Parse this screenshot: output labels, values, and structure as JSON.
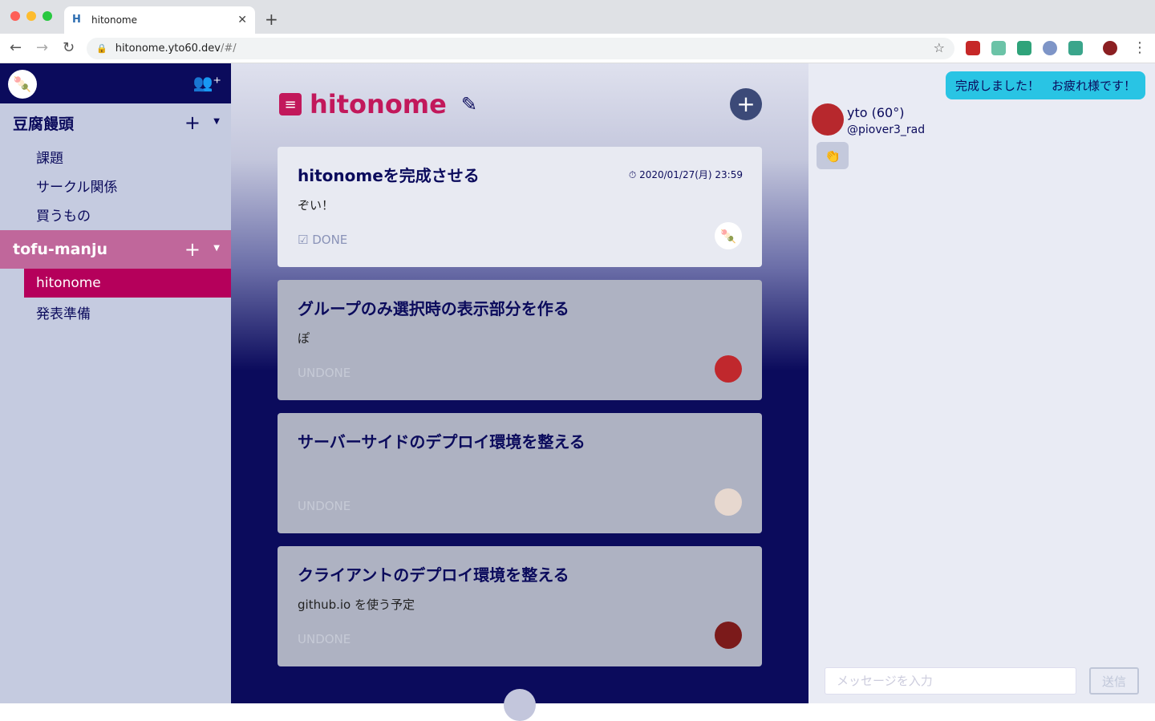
{
  "browser": {
    "tab_title": "hitonome",
    "url_host": "hitonome.yto60.dev",
    "url_path": "/#/"
  },
  "sidebar": {
    "groups": [
      {
        "name": "豆腐饅頭",
        "items": [
          "課題",
          "サークル関係",
          "買うもの"
        ]
      },
      {
        "name": "tofu-manju",
        "items": [
          "hitonome",
          "発表準備"
        ],
        "active_item": "hitonome"
      }
    ]
  },
  "main": {
    "title": "hitonome",
    "tasks": [
      {
        "title": "hitonomeを完成させる",
        "date": "⏱ 2020/01/27(月) 23:59",
        "desc": "ぞい！",
        "status": "☑ DONE"
      },
      {
        "title": "グループのみ選択時の表示部分を作る",
        "desc": "ぽ",
        "status": "UNDONE"
      },
      {
        "title": "サーバーサイドのデプロイ環境を整える",
        "desc": "",
        "status": "UNDONE"
      },
      {
        "title": "クライアントのデプロイ環境を整える",
        "desc": "github.io を使う予定",
        "status": "UNDONE"
      }
    ]
  },
  "chat": {
    "message": "完成しました！　お疲れ様です！",
    "user_name": "yto (60°)",
    "user_handle": "@piover3_rad",
    "reaction": "👏",
    "input_placeholder": "メッセージを入力",
    "send_label": "送信"
  },
  "colors": {
    "navy": "#0b0b5c",
    "accent": "#c2185b",
    "chat_bubble": "#29c4e4"
  }
}
